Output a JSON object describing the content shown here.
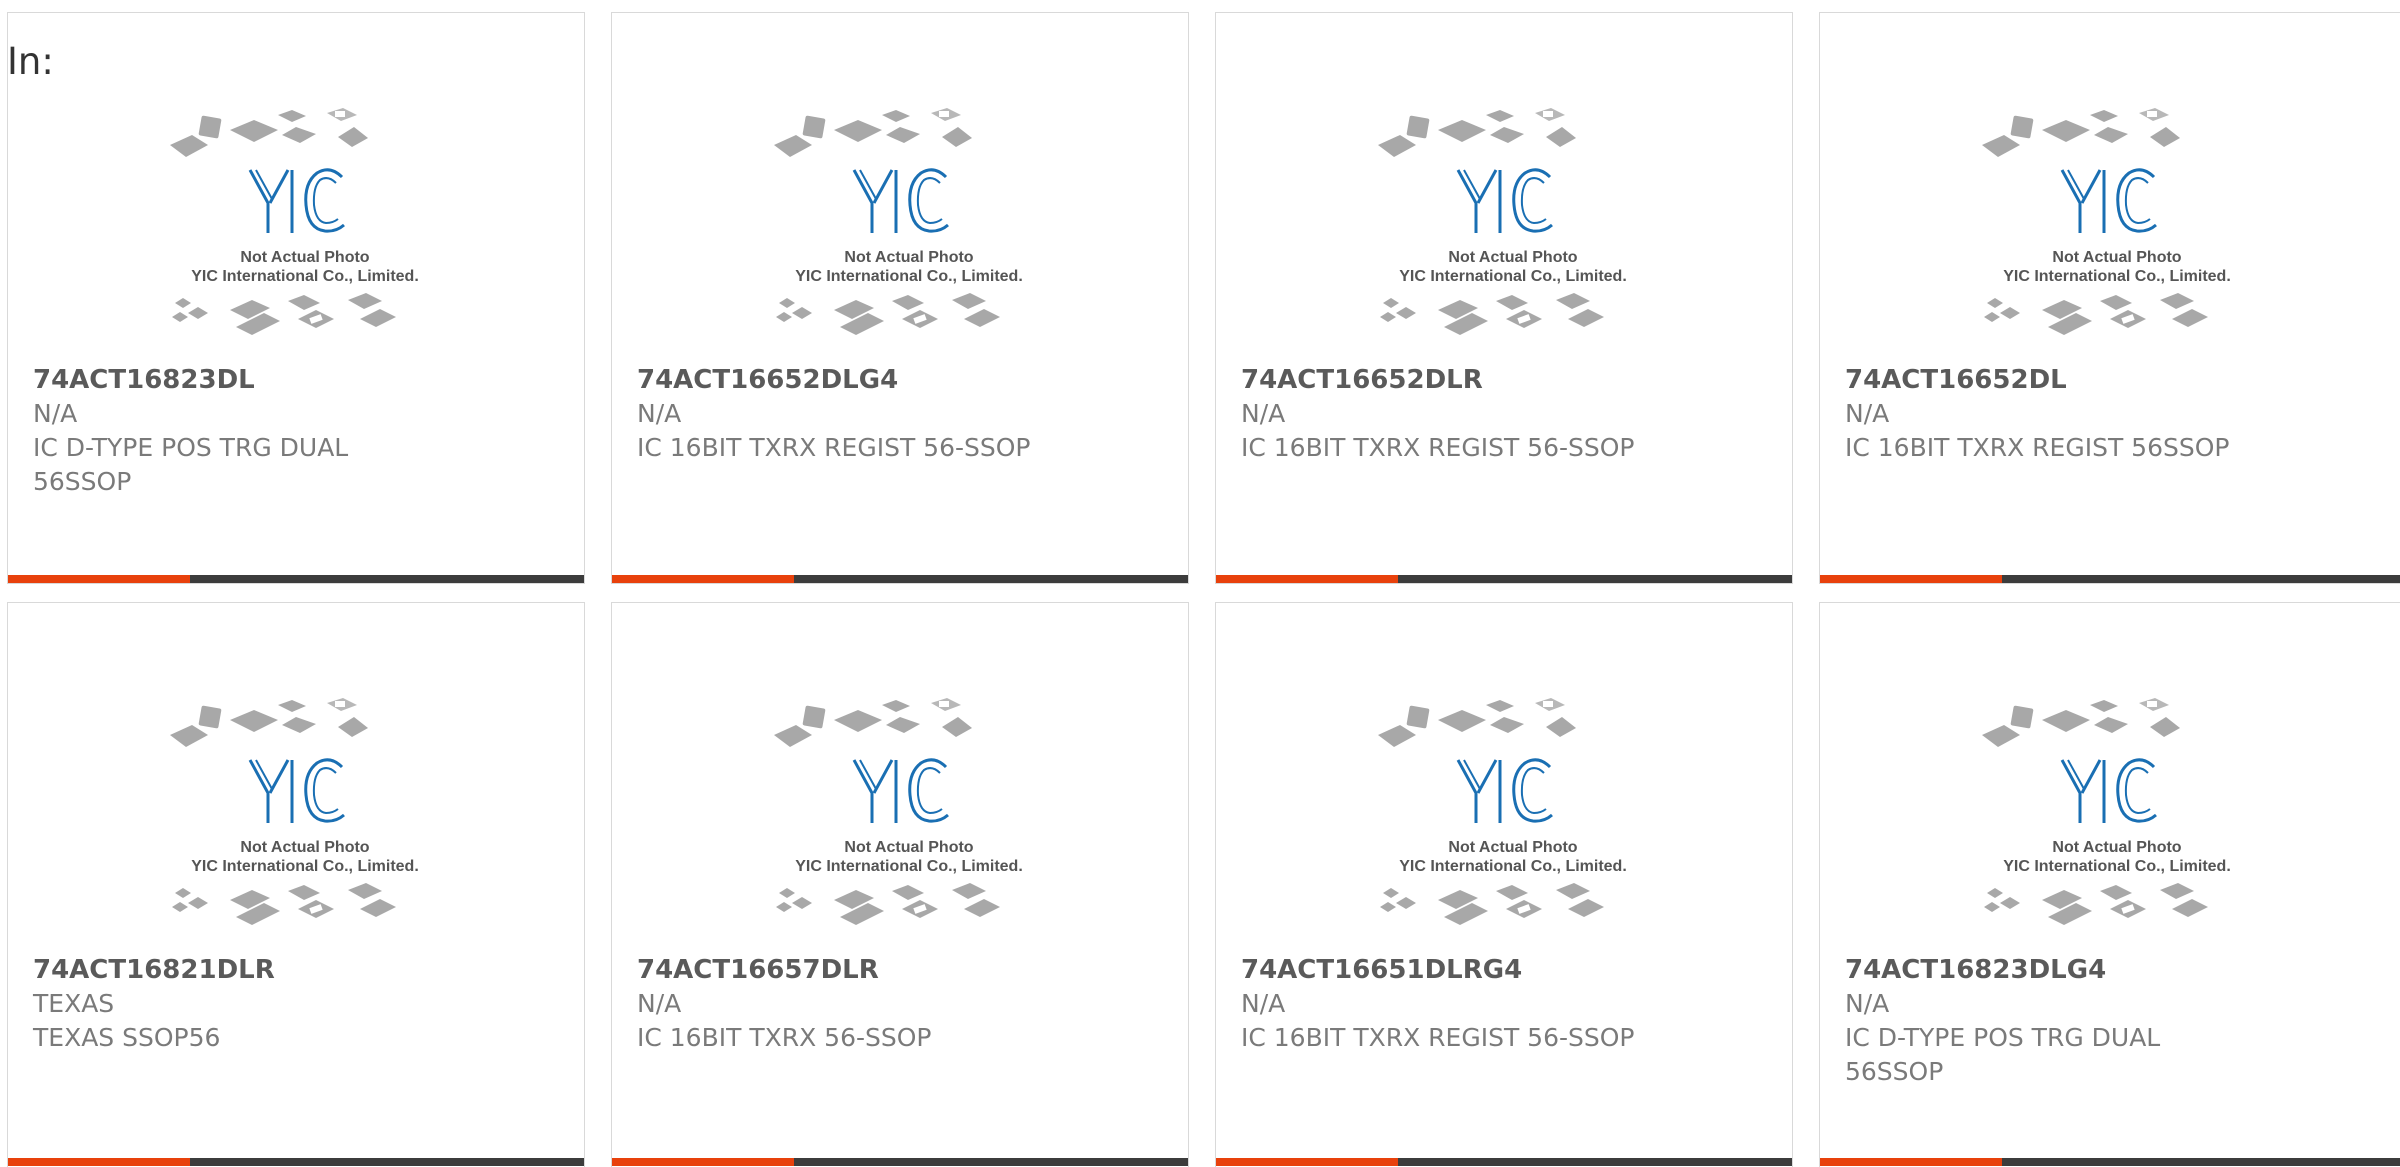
{
  "header": {
    "in_label": "In:"
  },
  "placeholder": {
    "line1": "Not Actual Photo",
    "line2": "YIC International Co., Limited.",
    "logo": "YIC"
  },
  "colors": {
    "accent": "#e8410c",
    "bar": "#3c3c3c",
    "logo_blue": "#1a6fb3",
    "chip_gray": "#a8a8a8"
  },
  "products": [
    {
      "part": "74ACT16823DL",
      "mfr": "N/A",
      "desc": "IC D-TYPE POS TRG DUAL 56SSOP"
    },
    {
      "part": "74ACT16652DLG4",
      "mfr": "N/A",
      "desc": "IC 16BIT TXRX REGIST 56-SSOP"
    },
    {
      "part": "74ACT16652DLR",
      "mfr": "N/A",
      "desc": "IC 16BIT TXRX REGIST 56-SSOP"
    },
    {
      "part": "74ACT16652DL",
      "mfr": "N/A",
      "desc": "IC 16BIT TXRX REGIST 56SSOP"
    },
    {
      "part": "74ACT16821DLR",
      "mfr": "TEXAS",
      "desc": "TEXAS SSOP56"
    },
    {
      "part": "74ACT16657DLR",
      "mfr": "N/A",
      "desc": "IC 16BIT TXRX 56-SSOP"
    },
    {
      "part": "74ACT16651DLRG4",
      "mfr": "N/A",
      "desc": "IC 16BIT TXRX REGIST 56-SSOP"
    },
    {
      "part": "74ACT16823DLG4",
      "mfr": "N/A",
      "desc": "IC D-TYPE POS TRG DUAL 56SSOP"
    }
  ]
}
